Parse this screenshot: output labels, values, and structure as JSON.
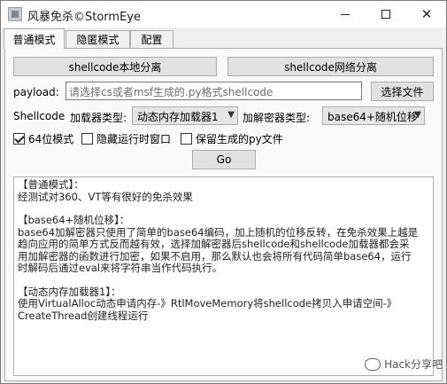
{
  "window": {
    "title": "风暴免杀©StormEye",
    "minimize": "—",
    "maximize": "☐",
    "close": "✕"
  },
  "tabs": [
    {
      "label": "普通模式",
      "active": true
    },
    {
      "label": "隐匿模式",
      "active": false
    },
    {
      "label": "配置",
      "active": false
    }
  ],
  "buttons": {
    "local_split": "shellcode本地分离",
    "net_split": "shellcode网络分离",
    "choose_file": "选择文件",
    "go": "Go"
  },
  "payload": {
    "label": "payload:",
    "placeholder": "请选择cs或者msf生成的.py格式shellcode"
  },
  "loader": {
    "shellcode_label": "Shellcode",
    "label": "加载器类型:",
    "value": "动态内存加载器1"
  },
  "decryptor": {
    "label": "加解密器类型:",
    "value": "base64+随机位移"
  },
  "options": [
    {
      "label": "64位模式",
      "checked": true
    },
    {
      "label": "隐藏运行时窗口",
      "checked": false
    },
    {
      "label": "保留生成的py文件",
      "checked": false
    }
  ],
  "log": {
    "lines": [
      "【普通模式】：",
      "经测试对360、VT等有很好的免杀效果",
      "",
      "【base64+随机位移】：",
      "base64加解密器只使用了简单的base64编码，加上随机的位移反转，在免杀效果上越是",
      "趋向应用的简单方式反而越有效，选择加解密器后shellcode和shellcode加载器都会采",
      "用加解密器的函数进行加密，如果不启用，那么默认也会将所有代码简单base64，运行",
      "时解码后通过eval来将字符串当作代码执行。",
      "",
      "【动态内存加载器1】：",
      "使用VirtualAlloc动态申请内存-》RtlMoveMemory将shellcode拷贝入申请空间-》",
      "CreateThread创建线程运行"
    ]
  },
  "watermark": "Hack分享吧"
}
